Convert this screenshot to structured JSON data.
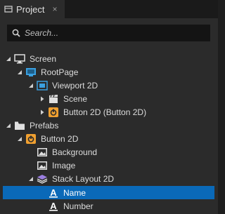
{
  "tab": {
    "title": "Project",
    "close_glyph": "×"
  },
  "search": {
    "placeholder": "Search..."
  },
  "tree": [
    {
      "label": "Screen",
      "icon": "monitor-icon",
      "expanded": true,
      "level": 0
    },
    {
      "label": "RootPage",
      "icon": "page-icon",
      "expanded": true,
      "level": 1
    },
    {
      "label": "Viewport 2D",
      "icon": "viewport-icon",
      "expanded": true,
      "level": 2
    },
    {
      "label": "Scene",
      "icon": "clapperboard-icon",
      "expanded": false,
      "level": 3
    },
    {
      "label": "Button 2D (Button 2D)",
      "icon": "power-button-icon",
      "expanded": false,
      "level": 3
    },
    {
      "label": "Prefabs",
      "icon": "folder-icon",
      "expanded": true,
      "level": 0
    },
    {
      "label": "Button 2D",
      "icon": "power-button-icon",
      "expanded": true,
      "level": 1
    },
    {
      "label": "Background",
      "icon": "image-icon",
      "expanded": null,
      "level": 2
    },
    {
      "label": "Image",
      "icon": "image-icon",
      "expanded": null,
      "level": 2
    },
    {
      "label": "Stack Layout 2D",
      "icon": "layers-icon",
      "expanded": true,
      "level": 2
    },
    {
      "label": "Name",
      "icon": "text-block-icon",
      "expanded": null,
      "level": 3,
      "selected": true
    },
    {
      "label": "Number",
      "icon": "text-block-icon",
      "expanded": null,
      "level": 3
    }
  ],
  "colors": {
    "accent": "#0a69b8",
    "orange": "#f0a030",
    "blue": "#3aa0e0"
  }
}
